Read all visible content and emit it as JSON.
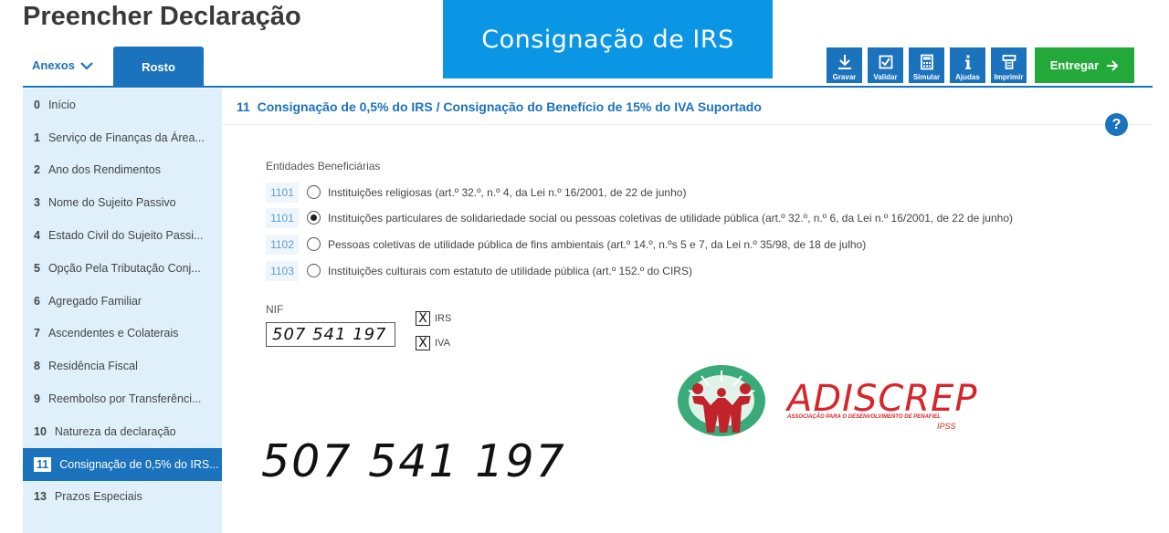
{
  "header": {
    "page_title": "Preencher Declaração",
    "banner": "Consignação de IRS"
  },
  "tabs": {
    "anexos": "Anexos",
    "rosto": "Rosto"
  },
  "toolbar": {
    "gravar": "Gravar",
    "validar": "Validar",
    "simular": "Simular",
    "ajudas": "Ajudas",
    "imprimir": "Imprimir",
    "entregar": "Entregar"
  },
  "sidebar": {
    "items": [
      {
        "num": "0",
        "label": "Início"
      },
      {
        "num": "1",
        "label": "Serviço de Finanças da Área..."
      },
      {
        "num": "2",
        "label": "Ano dos Rendimentos"
      },
      {
        "num": "3",
        "label": "Nome do Sujeito Passivo"
      },
      {
        "num": "4",
        "label": "Estado Civil do Sujeito Passi..."
      },
      {
        "num": "5",
        "label": "Opção Pela Tributação Conj..."
      },
      {
        "num": "6",
        "label": "Agregado Familiar"
      },
      {
        "num": "7",
        "label": "Ascendentes e Colaterais"
      },
      {
        "num": "8",
        "label": "Residência Fiscal"
      },
      {
        "num": "9",
        "label": "Reembolso por Transferênci..."
      },
      {
        "num": "10",
        "label": "Natureza da declaração"
      },
      {
        "num": "11",
        "label": "Consignação de 0,5% do IRS..."
      },
      {
        "num": "13",
        "label": "Prazos Especiais"
      }
    ]
  },
  "section": {
    "number": "11",
    "title": "Consignação de 0,5% do IRS / Consignação do Benefício de 15% do IVA Suportado"
  },
  "entities": {
    "label": "Entidades Beneficiárias",
    "options": [
      {
        "code": "1101",
        "text": "Instituições religiosas (art.º 32.º, n.º 4, da Lei n.º 16/2001, de 22 de junho)",
        "selected": false
      },
      {
        "code": "1101",
        "text": "Instituições particulares de solidariedade social ou pessoas coletivas de utilidade pública (art.º 32.º, n.º 6, da Lei n.º 16/2001, de 22 de junho)",
        "selected": true
      },
      {
        "code": "1102",
        "text": "Pessoas coletivas de utilidade pública de fins ambientais (art.º 14.º, n.ºs 5 e 7, da Lei n.º 35/98, de 18 de julho)",
        "selected": false
      },
      {
        "code": "1103",
        "text": "Instituições culturais com estatuto de utilidade pública (art.º 152.º do CIRS)",
        "selected": false
      }
    ]
  },
  "nif": {
    "label": "NIF",
    "value": "507 541 197",
    "irs_label": "IRS",
    "irs_mark": "X",
    "iva_label": "IVA",
    "iva_mark": "X"
  },
  "overlay": {
    "big_nif": "507 541 197"
  },
  "logo": {
    "name": "ADISCREP",
    "subtitle": "ASSOCIAÇÃO PARA O DESENVOLVIMENTO DE PENAFIEL",
    "ipss": "IPSS"
  },
  "help_glyph": "?",
  "colors": {
    "primary": "#1b72bd",
    "banner": "#0b96e5",
    "entregar": "#22a93a",
    "sidebar_bg": "#dff0fb",
    "logo_red": "#d7262b",
    "logo_green": "#3aaa7a"
  }
}
